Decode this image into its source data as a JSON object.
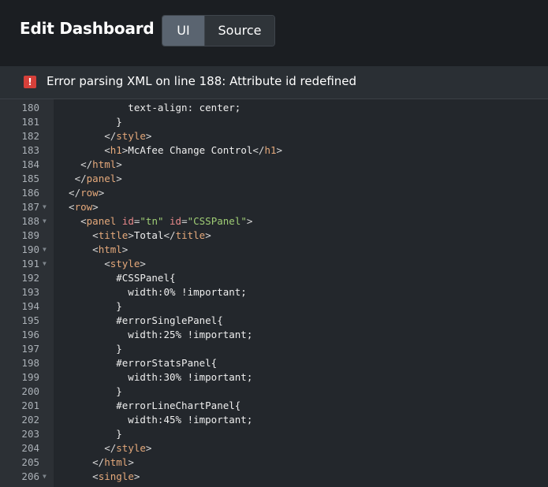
{
  "header": {
    "title": "Edit Dashboard",
    "tabs": [
      {
        "label": "UI",
        "active": true
      },
      {
        "label": "Source",
        "active": false
      }
    ]
  },
  "error": {
    "message": "Error parsing XML on line 188: Attribute id redefined",
    "icon": "error-icon"
  },
  "colors": {
    "header_bg": "#1b1e22",
    "editor_bg": "#23272c",
    "error_icon": "#d6403a",
    "tag": "#e5a97b",
    "attr": "#e8888a",
    "string": "#9fcd75"
  },
  "code": [
    {
      "n": "180",
      "fold": false,
      "segs": [
        [
          "x",
          "            text-align: center;"
        ]
      ]
    },
    {
      "n": "181",
      "fold": false,
      "segs": [
        [
          "x",
          "          }"
        ]
      ]
    },
    {
      "n": "182",
      "fold": false,
      "segs": [
        [
          "p",
          "        </"
        ],
        [
          "t",
          "style"
        ],
        [
          "p",
          ">"
        ]
      ]
    },
    {
      "n": "183",
      "fold": false,
      "segs": [
        [
          "p",
          "        <"
        ],
        [
          "t",
          "h1"
        ],
        [
          "p",
          ">"
        ],
        [
          "x",
          "McAfee Change Control"
        ],
        [
          "p",
          "</"
        ],
        [
          "t",
          "h1"
        ],
        [
          "p",
          ">"
        ]
      ]
    },
    {
      "n": "184",
      "fold": false,
      "segs": [
        [
          "p",
          "    </"
        ],
        [
          "t",
          "html"
        ],
        [
          "p",
          ">"
        ]
      ]
    },
    {
      "n": "185",
      "fold": false,
      "segs": [
        [
          "p",
          "   </"
        ],
        [
          "t",
          "panel"
        ],
        [
          "p",
          ">"
        ]
      ]
    },
    {
      "n": "186",
      "fold": false,
      "segs": [
        [
          "p",
          "  </"
        ],
        [
          "t",
          "row"
        ],
        [
          "p",
          ">"
        ]
      ]
    },
    {
      "n": "187",
      "fold": true,
      "segs": [
        [
          "p",
          "  <"
        ],
        [
          "t",
          "row"
        ],
        [
          "p",
          ">"
        ]
      ]
    },
    {
      "n": "188",
      "fold": true,
      "segs": [
        [
          "p",
          "    <"
        ],
        [
          "t",
          "panel "
        ],
        [
          "a",
          "id"
        ],
        [
          "p",
          "="
        ],
        [
          "s",
          "\"tn\""
        ],
        [
          "a",
          " id"
        ],
        [
          "p",
          "="
        ],
        [
          "s",
          "\"CSSPanel\""
        ],
        [
          "p",
          ">"
        ]
      ]
    },
    {
      "n": "189",
      "fold": false,
      "segs": [
        [
          "p",
          "      <"
        ],
        [
          "t",
          "title"
        ],
        [
          "p",
          ">"
        ],
        [
          "x",
          "Total"
        ],
        [
          "p",
          "</"
        ],
        [
          "t",
          "title"
        ],
        [
          "p",
          ">"
        ]
      ]
    },
    {
      "n": "190",
      "fold": true,
      "segs": [
        [
          "p",
          "      <"
        ],
        [
          "t",
          "html"
        ],
        [
          "p",
          ">"
        ]
      ]
    },
    {
      "n": "191",
      "fold": true,
      "segs": [
        [
          "p",
          "        <"
        ],
        [
          "t",
          "style"
        ],
        [
          "p",
          ">"
        ]
      ]
    },
    {
      "n": "192",
      "fold": false,
      "segs": [
        [
          "x",
          "          #CSSPanel{"
        ]
      ]
    },
    {
      "n": "193",
      "fold": false,
      "segs": [
        [
          "x",
          "            width:0% !important;"
        ]
      ]
    },
    {
      "n": "194",
      "fold": false,
      "segs": [
        [
          "x",
          "          }"
        ]
      ]
    },
    {
      "n": "195",
      "fold": false,
      "segs": [
        [
          "x",
          "          #errorSinglePanel{"
        ]
      ]
    },
    {
      "n": "196",
      "fold": false,
      "segs": [
        [
          "x",
          "            width:25% !important;"
        ]
      ]
    },
    {
      "n": "197",
      "fold": false,
      "segs": [
        [
          "x",
          "          }"
        ]
      ]
    },
    {
      "n": "198",
      "fold": false,
      "segs": [
        [
          "x",
          "          #errorStatsPanel{"
        ]
      ]
    },
    {
      "n": "199",
      "fold": false,
      "segs": [
        [
          "x",
          "            width:30% !important;"
        ]
      ]
    },
    {
      "n": "200",
      "fold": false,
      "segs": [
        [
          "x",
          "          }"
        ]
      ]
    },
    {
      "n": "201",
      "fold": false,
      "segs": [
        [
          "x",
          "          #errorLineChartPanel{"
        ]
      ]
    },
    {
      "n": "202",
      "fold": false,
      "segs": [
        [
          "x",
          "            width:45% !important;"
        ]
      ]
    },
    {
      "n": "203",
      "fold": false,
      "segs": [
        [
          "x",
          "          }"
        ]
      ]
    },
    {
      "n": "204",
      "fold": false,
      "segs": [
        [
          "p",
          "        </"
        ],
        [
          "t",
          "style"
        ],
        [
          "p",
          ">"
        ]
      ]
    },
    {
      "n": "205",
      "fold": false,
      "segs": [
        [
          "p",
          "      </"
        ],
        [
          "t",
          "html"
        ],
        [
          "p",
          ">"
        ]
      ]
    },
    {
      "n": "206",
      "fold": true,
      "segs": [
        [
          "p",
          "      <"
        ],
        [
          "t",
          "single"
        ],
        [
          "p",
          ">"
        ]
      ]
    }
  ]
}
